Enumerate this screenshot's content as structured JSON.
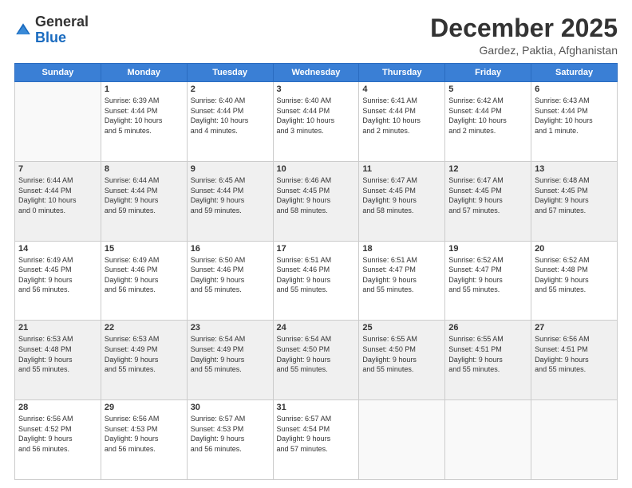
{
  "logo": {
    "general": "General",
    "blue": "Blue"
  },
  "header": {
    "month": "December 2025",
    "location": "Gardez, Paktia, Afghanistan"
  },
  "days_of_week": [
    "Sunday",
    "Monday",
    "Tuesday",
    "Wednesday",
    "Thursday",
    "Friday",
    "Saturday"
  ],
  "weeks": [
    [
      {
        "day": "",
        "info": ""
      },
      {
        "day": "1",
        "info": "Sunrise: 6:39 AM\nSunset: 4:44 PM\nDaylight: 10 hours\nand 5 minutes."
      },
      {
        "day": "2",
        "info": "Sunrise: 6:40 AM\nSunset: 4:44 PM\nDaylight: 10 hours\nand 4 minutes."
      },
      {
        "day": "3",
        "info": "Sunrise: 6:40 AM\nSunset: 4:44 PM\nDaylight: 10 hours\nand 3 minutes."
      },
      {
        "day": "4",
        "info": "Sunrise: 6:41 AM\nSunset: 4:44 PM\nDaylight: 10 hours\nand 2 minutes."
      },
      {
        "day": "5",
        "info": "Sunrise: 6:42 AM\nSunset: 4:44 PM\nDaylight: 10 hours\nand 2 minutes."
      },
      {
        "day": "6",
        "info": "Sunrise: 6:43 AM\nSunset: 4:44 PM\nDaylight: 10 hours\nand 1 minute."
      }
    ],
    [
      {
        "day": "7",
        "info": "Sunrise: 6:44 AM\nSunset: 4:44 PM\nDaylight: 10 hours\nand 0 minutes."
      },
      {
        "day": "8",
        "info": "Sunrise: 6:44 AM\nSunset: 4:44 PM\nDaylight: 9 hours\nand 59 minutes."
      },
      {
        "day": "9",
        "info": "Sunrise: 6:45 AM\nSunset: 4:44 PM\nDaylight: 9 hours\nand 59 minutes."
      },
      {
        "day": "10",
        "info": "Sunrise: 6:46 AM\nSunset: 4:45 PM\nDaylight: 9 hours\nand 58 minutes."
      },
      {
        "day": "11",
        "info": "Sunrise: 6:47 AM\nSunset: 4:45 PM\nDaylight: 9 hours\nand 58 minutes."
      },
      {
        "day": "12",
        "info": "Sunrise: 6:47 AM\nSunset: 4:45 PM\nDaylight: 9 hours\nand 57 minutes."
      },
      {
        "day": "13",
        "info": "Sunrise: 6:48 AM\nSunset: 4:45 PM\nDaylight: 9 hours\nand 57 minutes."
      }
    ],
    [
      {
        "day": "14",
        "info": "Sunrise: 6:49 AM\nSunset: 4:45 PM\nDaylight: 9 hours\nand 56 minutes."
      },
      {
        "day": "15",
        "info": "Sunrise: 6:49 AM\nSunset: 4:46 PM\nDaylight: 9 hours\nand 56 minutes."
      },
      {
        "day": "16",
        "info": "Sunrise: 6:50 AM\nSunset: 4:46 PM\nDaylight: 9 hours\nand 55 minutes."
      },
      {
        "day": "17",
        "info": "Sunrise: 6:51 AM\nSunset: 4:46 PM\nDaylight: 9 hours\nand 55 minutes."
      },
      {
        "day": "18",
        "info": "Sunrise: 6:51 AM\nSunset: 4:47 PM\nDaylight: 9 hours\nand 55 minutes."
      },
      {
        "day": "19",
        "info": "Sunrise: 6:52 AM\nSunset: 4:47 PM\nDaylight: 9 hours\nand 55 minutes."
      },
      {
        "day": "20",
        "info": "Sunrise: 6:52 AM\nSunset: 4:48 PM\nDaylight: 9 hours\nand 55 minutes."
      }
    ],
    [
      {
        "day": "21",
        "info": "Sunrise: 6:53 AM\nSunset: 4:48 PM\nDaylight: 9 hours\nand 55 minutes."
      },
      {
        "day": "22",
        "info": "Sunrise: 6:53 AM\nSunset: 4:49 PM\nDaylight: 9 hours\nand 55 minutes."
      },
      {
        "day": "23",
        "info": "Sunrise: 6:54 AM\nSunset: 4:49 PM\nDaylight: 9 hours\nand 55 minutes."
      },
      {
        "day": "24",
        "info": "Sunrise: 6:54 AM\nSunset: 4:50 PM\nDaylight: 9 hours\nand 55 minutes."
      },
      {
        "day": "25",
        "info": "Sunrise: 6:55 AM\nSunset: 4:50 PM\nDaylight: 9 hours\nand 55 minutes."
      },
      {
        "day": "26",
        "info": "Sunrise: 6:55 AM\nSunset: 4:51 PM\nDaylight: 9 hours\nand 55 minutes."
      },
      {
        "day": "27",
        "info": "Sunrise: 6:56 AM\nSunset: 4:51 PM\nDaylight: 9 hours\nand 55 minutes."
      }
    ],
    [
      {
        "day": "28",
        "info": "Sunrise: 6:56 AM\nSunset: 4:52 PM\nDaylight: 9 hours\nand 56 minutes."
      },
      {
        "day": "29",
        "info": "Sunrise: 6:56 AM\nSunset: 4:53 PM\nDaylight: 9 hours\nand 56 minutes."
      },
      {
        "day": "30",
        "info": "Sunrise: 6:57 AM\nSunset: 4:53 PM\nDaylight: 9 hours\nand 56 minutes."
      },
      {
        "day": "31",
        "info": "Sunrise: 6:57 AM\nSunset: 4:54 PM\nDaylight: 9 hours\nand 57 minutes."
      },
      {
        "day": "",
        "info": ""
      },
      {
        "day": "",
        "info": ""
      },
      {
        "day": "",
        "info": ""
      }
    ]
  ]
}
